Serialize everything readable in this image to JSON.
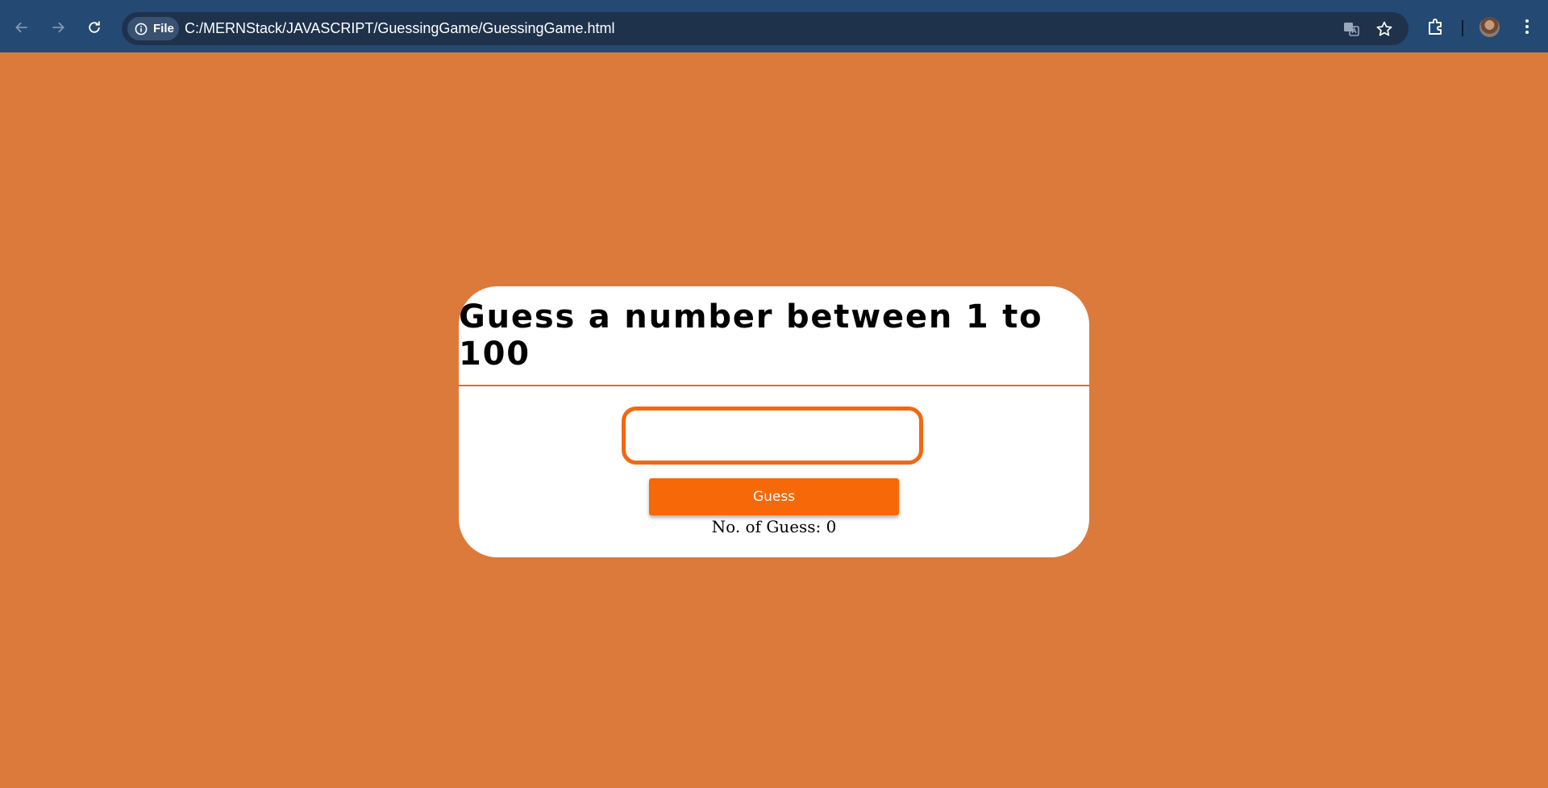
{
  "browser": {
    "chip_label": "File",
    "url": "C:/MERNStack/JAVASCRIPT/GuessingGame/GuessingGame.html",
    "icons": [
      "back-arrow-icon",
      "forward-arrow-icon",
      "reload-icon",
      "info-icon",
      "translate-icon",
      "star-icon",
      "extensions-icon",
      "avatar",
      "more-vert-icon"
    ]
  },
  "game": {
    "title": "Guess a number between 1 to 100",
    "input_value": "",
    "button_label": "Guess",
    "guess_count_text": "No. of Guess: 0"
  },
  "colors": {
    "page_background": "#dc7a3b",
    "browser_bar": "#244a73",
    "omnibox": "#1e324c",
    "accent": "#f76808",
    "card": "#ffffff"
  }
}
